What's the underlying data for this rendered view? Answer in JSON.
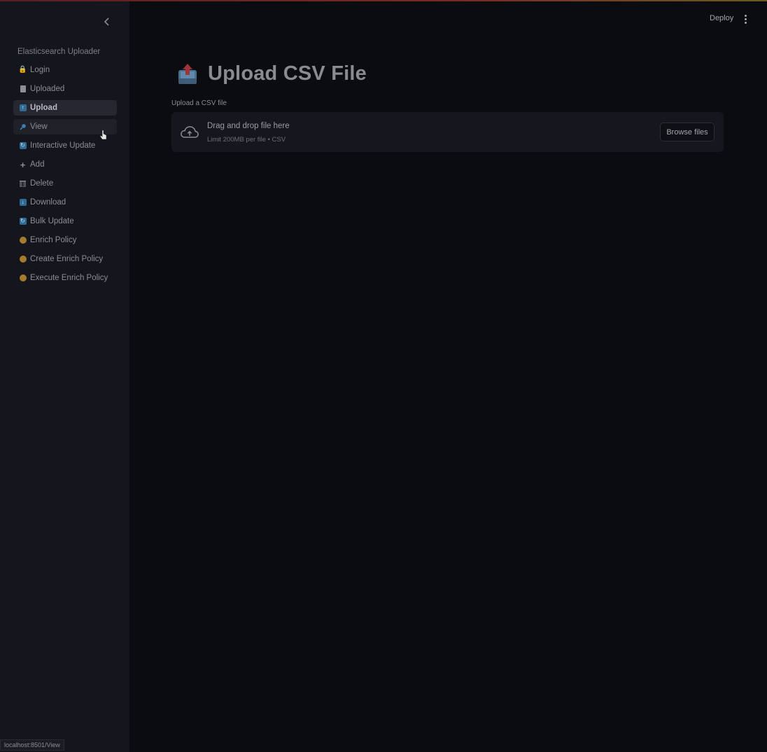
{
  "sidebar": {
    "title": "Elasticsearch Uploader",
    "items": [
      {
        "label": "Login",
        "icon": "lock-icon"
      },
      {
        "label": "Uploaded",
        "icon": "page-icon"
      },
      {
        "label": "Upload",
        "icon": "upload-arrow-icon",
        "active": true
      },
      {
        "label": "View",
        "icon": "magnifier-icon",
        "hover": true
      },
      {
        "label": "Interactive Update",
        "icon": "refresh-icon"
      },
      {
        "label": "Add",
        "icon": "plus-icon"
      },
      {
        "label": "Delete",
        "icon": "wastebasket-icon"
      },
      {
        "label": "Download",
        "icon": "download-arrow-icon"
      },
      {
        "label": "Bulk Update",
        "icon": "refresh-icon"
      },
      {
        "label": "Enrich Policy",
        "icon": "orange-circle-icon"
      },
      {
        "label": "Create Enrich Policy",
        "icon": "orange-circle-icon"
      },
      {
        "label": "Execute Enrich Policy",
        "icon": "orange-circle-icon"
      }
    ],
    "status_url": "localhost:8501/View"
  },
  "header": {
    "deploy_label": "Deploy"
  },
  "main": {
    "title": "Upload CSV File",
    "title_icon": "outbox-tray-icon",
    "uploader": {
      "label": "Upload a CSV file",
      "drop_text": "Drag and drop file here",
      "limit_text": "Limit 200MB per file • CSV",
      "browse_label": "Browse files"
    }
  },
  "colors": {
    "background": "#0b0c10",
    "sidebar": "#15161d",
    "active_item": "#262730",
    "accent_orange": "#a57b2c",
    "accent_blue": "#2f6b95"
  }
}
